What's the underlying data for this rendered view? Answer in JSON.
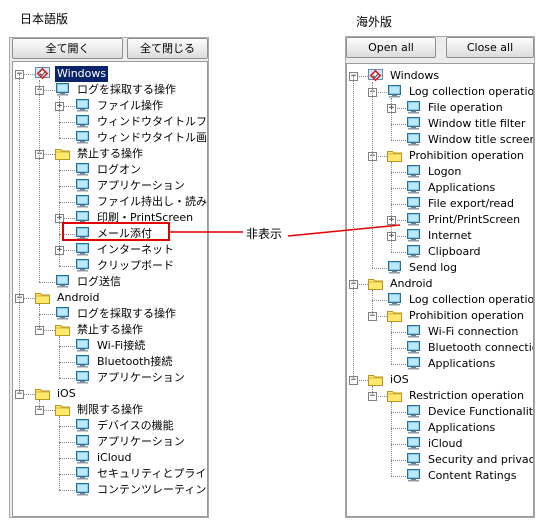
{
  "headings": {
    "ja": "日本語版",
    "en": "海外版"
  },
  "ja": {
    "buttons": {
      "open_all": "全て開く",
      "close_all": "全て閉じる"
    },
    "tree": [
      {
        "d": 0,
        "e": "-",
        "i": "win",
        "t": "Windows",
        "sel": true
      },
      {
        "d": 1,
        "e": "-",
        "i": "pc",
        "t": "ログを採取する操作"
      },
      {
        "d": 2,
        "e": "+",
        "i": "pc",
        "t": "ファイル操作"
      },
      {
        "d": 2,
        "i": "pc",
        "t": "ウィンドウタイトルフィルタ"
      },
      {
        "d": 2,
        "i": "pc",
        "t": "ウィンドウタイトル画面キャ"
      },
      {
        "d": 1,
        "e": "-",
        "i": "folder",
        "t": "禁止する操作"
      },
      {
        "d": 2,
        "i": "pc",
        "t": "ログオン"
      },
      {
        "d": 2,
        "i": "pc",
        "t": "アプリケーション"
      },
      {
        "d": 2,
        "i": "pc",
        "t": "ファイル持出し・読み込み"
      },
      {
        "d": 2,
        "e": "+",
        "i": "pc",
        "t": "印刷・PrintScreen"
      },
      {
        "d": 2,
        "i": "pc",
        "t": "メール添付",
        "boxed": true
      },
      {
        "d": 2,
        "e": "+",
        "i": "pc",
        "t": "インターネット"
      },
      {
        "d": 2,
        "i": "pc",
        "t": "クリップボード"
      },
      {
        "d": 1,
        "i": "pc",
        "t": "ログ送信"
      },
      {
        "d": 0,
        "e": "-",
        "i": "folder",
        "t": "Android"
      },
      {
        "d": 1,
        "i": "pc",
        "t": "ログを採取する操作"
      },
      {
        "d": 1,
        "e": "-",
        "i": "folder",
        "t": "禁止する操作"
      },
      {
        "d": 2,
        "i": "pc",
        "t": "Wi-Fi接続"
      },
      {
        "d": 2,
        "i": "pc",
        "t": "Bluetooth接続"
      },
      {
        "d": 2,
        "i": "pc",
        "t": "アプリケーション"
      },
      {
        "d": 0,
        "e": "-",
        "i": "folder",
        "t": "iOS"
      },
      {
        "d": 1,
        "e": "-",
        "i": "folder",
        "t": "制限する操作"
      },
      {
        "d": 2,
        "i": "pc",
        "t": "デバイスの機能"
      },
      {
        "d": 2,
        "i": "pc",
        "t": "アプリケーション"
      },
      {
        "d": 2,
        "i": "pc",
        "t": "iCloud"
      },
      {
        "d": 2,
        "i": "pc",
        "t": "セキュリティとプライバシー"
      },
      {
        "d": 2,
        "i": "pc",
        "t": "コンテンツレーティング"
      }
    ]
  },
  "en": {
    "buttons": {
      "open_all": "Open all",
      "close_all": "Close all"
    },
    "tree": [
      {
        "d": 0,
        "e": "-",
        "i": "win",
        "t": "Windows"
      },
      {
        "d": 1,
        "e": "-",
        "i": "pc",
        "t": "Log collection operation"
      },
      {
        "d": 2,
        "e": "+",
        "i": "pc",
        "t": "File operation"
      },
      {
        "d": 2,
        "i": "pc",
        "t": "Window title filter"
      },
      {
        "d": 2,
        "i": "pc",
        "t": "Window title screen c"
      },
      {
        "d": 1,
        "e": "-",
        "i": "folder",
        "t": "Prohibition operation"
      },
      {
        "d": 2,
        "i": "pc",
        "t": "Logon"
      },
      {
        "d": 2,
        "i": "pc",
        "t": "Applications"
      },
      {
        "d": 2,
        "i": "pc",
        "t": "File export/read"
      },
      {
        "d": 2,
        "e": "+",
        "i": "pc",
        "t": "Print/PrintScreen"
      },
      {
        "d": 2,
        "e": "+",
        "i": "pc",
        "t": "Internet"
      },
      {
        "d": 2,
        "i": "pc",
        "t": "Clipboard"
      },
      {
        "d": 1,
        "i": "pc",
        "t": "Send log"
      },
      {
        "d": 0,
        "e": "-",
        "i": "folder",
        "t": "Android"
      },
      {
        "d": 1,
        "i": "pc",
        "t": "Log collection operation"
      },
      {
        "d": 1,
        "e": "-",
        "i": "folder",
        "t": "Prohibition operation"
      },
      {
        "d": 2,
        "i": "pc",
        "t": "Wi-Fi connection"
      },
      {
        "d": 2,
        "i": "pc",
        "t": "Bluetooth connection"
      },
      {
        "d": 2,
        "i": "pc",
        "t": "Applications"
      },
      {
        "d": 0,
        "e": "-",
        "i": "folder",
        "t": "iOS"
      },
      {
        "d": 1,
        "e": "-",
        "i": "folder",
        "t": "Restriction operation"
      },
      {
        "d": 2,
        "i": "pc",
        "t": "Device Functionality"
      },
      {
        "d": 2,
        "i": "pc",
        "t": "Applications"
      },
      {
        "d": 2,
        "i": "pc",
        "t": "iCloud"
      },
      {
        "d": 2,
        "i": "pc",
        "t": "Security and privacy"
      },
      {
        "d": 2,
        "i": "pc",
        "t": "Content Ratings"
      }
    ]
  },
  "annotation": {
    "label": "非表示",
    "color": "#e00000"
  }
}
